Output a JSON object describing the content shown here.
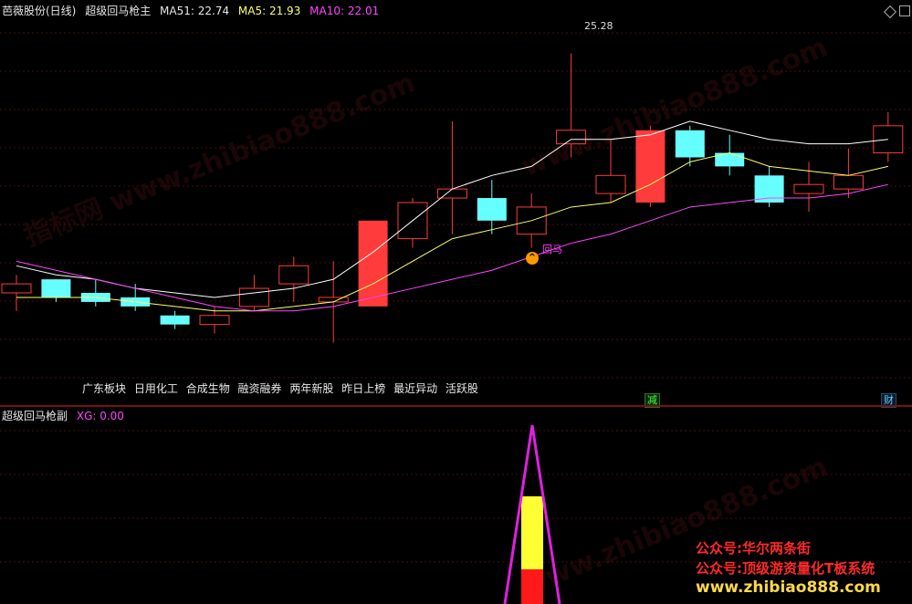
{
  "main_panel": {
    "stock_name": "芭薇股份(日线)",
    "indicator_name": "超级回马枪主",
    "ma51": "MA51: 22.74",
    "ma5": "MA5: 21.93",
    "ma10": "MA10: 22.01",
    "peak_value": "25.28",
    "signal_label": "回马",
    "signal_icon_name": "up-arrow-icon"
  },
  "sector_tags": [
    "广东板块",
    "日用化工",
    "合成生物",
    "融资融券",
    "两年新股",
    "昨日上榜",
    "最近异动",
    "活跃股"
  ],
  "event_tags": {
    "jian": "减",
    "cai": "财"
  },
  "sub_panel": {
    "indicator_name": "超级回马枪副",
    "xg": "XG: 0.00"
  },
  "watermarks": {
    "line1": "公众号:华尔两条街",
    "line2": "公众号:顶级游资量化T板系统",
    "line3": "www.zhibiao888.com",
    "ghost1": "指标网 www.zhibiao888.com",
    "ghost2": "www.zhibiao888.com"
  },
  "colors": {
    "up": "#ff3b3b",
    "down": "#66ffff",
    "ma51": "#ffffff",
    "ma5": "#ffff66",
    "ma10": "#ff44ff",
    "background": "#000000"
  },
  "chart_data": {
    "type": "candlestick",
    "ylim": [
      18.0,
      26.0
    ],
    "candles": [
      {
        "o": 20.0,
        "h": 20.4,
        "l": 19.6,
        "c": 20.2
      },
      {
        "o": 20.3,
        "h": 20.2,
        "l": 19.8,
        "c": 19.9
      },
      {
        "o": 20.0,
        "h": 20.3,
        "l": 19.7,
        "c": 19.8
      },
      {
        "o": 19.9,
        "h": 20.2,
        "l": 19.6,
        "c": 19.7
      },
      {
        "o": 19.5,
        "h": 19.6,
        "l": 19.2,
        "c": 19.3
      },
      {
        "o": 19.3,
        "h": 19.7,
        "l": 19.1,
        "c": 19.5
      },
      {
        "o": 19.7,
        "h": 20.4,
        "l": 19.6,
        "c": 20.1
      },
      {
        "o": 20.2,
        "h": 20.8,
        "l": 19.8,
        "c": 20.6
      },
      {
        "o": 19.8,
        "h": 20.7,
        "l": 18.9,
        "c": 19.9
      },
      {
        "o": 19.7,
        "h": 21.6,
        "l": 19.7,
        "c": 21.6
      },
      {
        "o": 21.2,
        "h": 22.1,
        "l": 21.0,
        "c": 22.0
      },
      {
        "o": 22.1,
        "h": 23.8,
        "l": 21.3,
        "c": 22.3
      },
      {
        "o": 22.1,
        "h": 22.5,
        "l": 21.3,
        "c": 21.6
      },
      {
        "o": 21.3,
        "h": 22.2,
        "l": 21.0,
        "c": 21.9
      },
      {
        "o": 23.3,
        "h": 25.3,
        "l": 23.0,
        "c": 23.6
      },
      {
        "o": 22.2,
        "h": 23.4,
        "l": 22.0,
        "c": 22.6
      },
      {
        "o": 22.0,
        "h": 23.7,
        "l": 21.9,
        "c": 23.6
      },
      {
        "o": 23.6,
        "h": 23.7,
        "l": 22.8,
        "c": 23.0
      },
      {
        "o": 23.1,
        "h": 23.5,
        "l": 22.6,
        "c": 22.8
      },
      {
        "o": 22.6,
        "h": 22.8,
        "l": 21.9,
        "c": 22.0
      },
      {
        "o": 22.2,
        "h": 22.9,
        "l": 21.8,
        "c": 22.4
      },
      {
        "o": 22.3,
        "h": 23.2,
        "l": 22.1,
        "c": 22.6
      },
      {
        "o": 23.1,
        "h": 24.0,
        "l": 22.9,
        "c": 23.7
      }
    ],
    "ma51": [
      20.6,
      20.4,
      20.3,
      20.1,
      20.0,
      19.9,
      20.0,
      20.1,
      20.3,
      20.9,
      21.6,
      22.3,
      22.6,
      22.8,
      23.4,
      23.4,
      23.5,
      23.8,
      23.6,
      23.4,
      23.3,
      23.3,
      23.4
    ],
    "ma5": [
      19.9,
      19.9,
      19.9,
      19.8,
      19.7,
      19.6,
      19.6,
      19.7,
      19.8,
      20.2,
      20.7,
      21.2,
      21.4,
      21.6,
      21.9,
      22.0,
      22.4,
      22.9,
      23.1,
      22.8,
      22.7,
      22.6,
      22.8
    ],
    "ma10": [
      20.7,
      20.5,
      20.3,
      20.1,
      19.9,
      19.7,
      19.6,
      19.6,
      19.7,
      19.9,
      20.1,
      20.3,
      20.5,
      20.8,
      21.1,
      21.3,
      21.6,
      21.9,
      22.0,
      22.1,
      22.1,
      22.2,
      22.4
    ]
  }
}
